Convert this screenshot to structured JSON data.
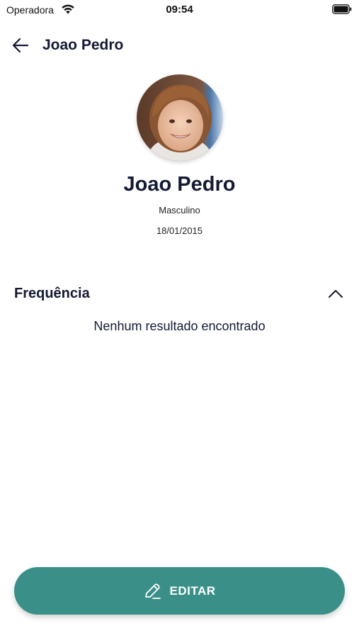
{
  "status_bar": {
    "carrier": "Operadora",
    "time": "09:54",
    "wifi_icon": "wifi-icon",
    "battery_icon": "battery-full-icon"
  },
  "nav": {
    "back_icon": "arrow-left-icon",
    "title": "Joao Pedro"
  },
  "profile": {
    "avatar": "child-photo",
    "name": "Joao Pedro",
    "gender": "Masculino",
    "birthdate": "18/01/2015"
  },
  "frequency_section": {
    "title": "Frequência",
    "toggle_icon": "chevron-up-icon",
    "expanded": true,
    "empty_message": "Nenhum resultado encontrado"
  },
  "footer": {
    "edit_icon": "pencil-icon",
    "edit_label": "EDITAR"
  },
  "colors": {
    "primary_text": "#141a33",
    "accent": "#3a9088",
    "background": "#ffffff"
  }
}
